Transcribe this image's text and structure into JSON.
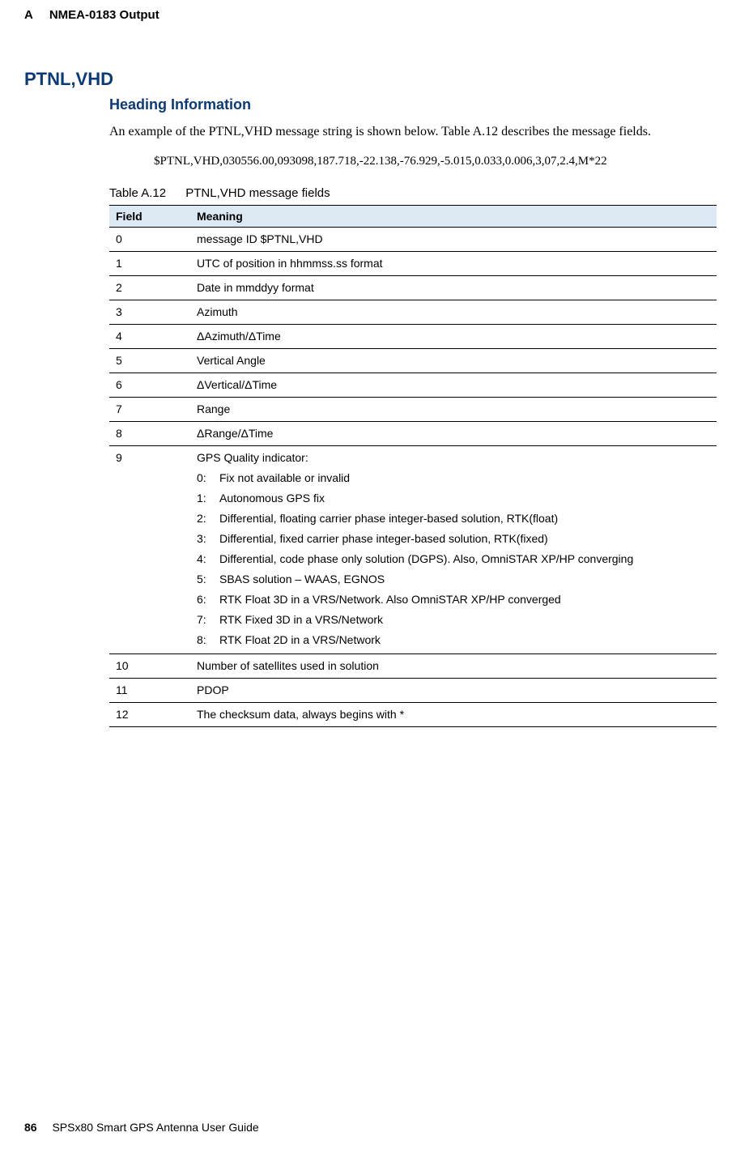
{
  "header": {
    "letter": "A",
    "title": "NMEA-0183 Output"
  },
  "section": {
    "main_heading": "PTNL,VHD",
    "sub_heading": "Heading Information",
    "intro_para": "An example of the PTNL,VHD message string is shown below. Table A.12 describes the message fields.",
    "example": "$PTNL,VHD,030556.00,093098,187.718,-22.138,-76.929,-5.015,0.033,0.006,3,07,2.4,M*22"
  },
  "table": {
    "caption_num": "Table A.12",
    "caption_title": "PTNL,VHD message fields",
    "headers": {
      "field": "Field",
      "meaning": "Meaning"
    },
    "rows": [
      {
        "field": "0",
        "meaning": "message ID $PTNL,VHD"
      },
      {
        "field": "1",
        "meaning": "UTC of position in hhmmss.ss format"
      },
      {
        "field": "2",
        "meaning": "Date in mmddyy format"
      },
      {
        "field": "3",
        "meaning": "Azimuth"
      },
      {
        "field": "4",
        "meaning": "ΔAzimuth/ΔTime"
      },
      {
        "field": "5",
        "meaning": "Vertical Angle"
      },
      {
        "field": "6",
        "meaning": "ΔVertical/ΔTime"
      },
      {
        "field": "7",
        "meaning": "Range"
      },
      {
        "field": "8",
        "meaning": "ΔRange/ΔTime"
      },
      {
        "field": "9",
        "meaning_label": "GPS Quality indicator:",
        "quality_list": [
          {
            "num": "0:",
            "text": "Fix not available or invalid"
          },
          {
            "num": "1:",
            "text": "Autonomous GPS fix"
          },
          {
            "num": "2:",
            "text": "Differential, floating carrier phase integer-based solution, RTK(float)"
          },
          {
            "num": "3:",
            "text": "Differential, fixed carrier phase integer-based solution, RTK(fixed)"
          },
          {
            "num": "4:",
            "text": "Differential, code phase only solution (DGPS). Also, OmniSTAR XP/HP converging"
          },
          {
            "num": "5:",
            "text": "SBAS solution – WAAS, EGNOS"
          },
          {
            "num": "6:",
            "text": "RTK Float 3D in a VRS/Network. Also OmniSTAR XP/HP converged"
          },
          {
            "num": "7:",
            "text": "RTK Fixed 3D in a VRS/Network"
          },
          {
            "num": "8:",
            "text": "RTK Float 2D in a VRS/Network"
          }
        ]
      },
      {
        "field": "10",
        "meaning": "Number of satellites used in solution"
      },
      {
        "field": "11",
        "meaning": "PDOP"
      },
      {
        "field": "12",
        "meaning": "The checksum data, always begins with *"
      }
    ]
  },
  "footer": {
    "page_num": "86",
    "book_title": "SPSx80 Smart GPS Antenna User Guide"
  }
}
